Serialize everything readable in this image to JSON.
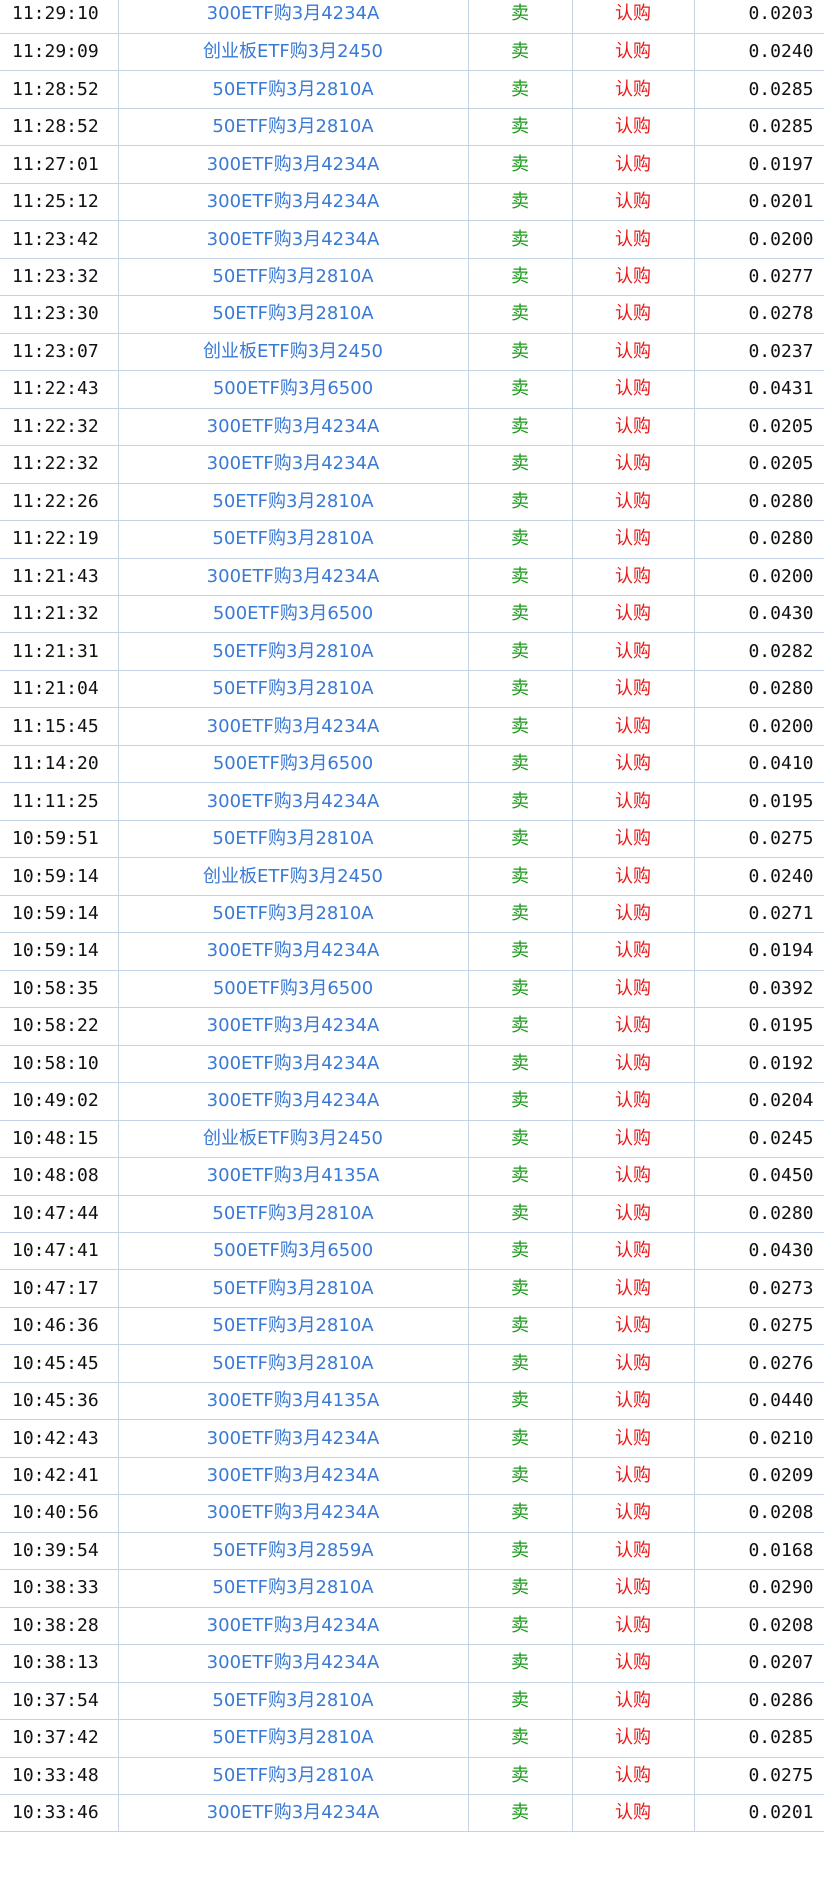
{
  "trades": [
    {
      "time": "11:29:10",
      "name": "300ETF购3月4234A",
      "side": "卖",
      "type": "认购",
      "price": "0.0203"
    },
    {
      "time": "11:29:09",
      "name": "创业板ETF购3月2450",
      "side": "卖",
      "type": "认购",
      "price": "0.0240"
    },
    {
      "time": "11:28:52",
      "name": "50ETF购3月2810A",
      "side": "卖",
      "type": "认购",
      "price": "0.0285"
    },
    {
      "time": "11:28:52",
      "name": "50ETF购3月2810A",
      "side": "卖",
      "type": "认购",
      "price": "0.0285"
    },
    {
      "time": "11:27:01",
      "name": "300ETF购3月4234A",
      "side": "卖",
      "type": "认购",
      "price": "0.0197"
    },
    {
      "time": "11:25:12",
      "name": "300ETF购3月4234A",
      "side": "卖",
      "type": "认购",
      "price": "0.0201"
    },
    {
      "time": "11:23:42",
      "name": "300ETF购3月4234A",
      "side": "卖",
      "type": "认购",
      "price": "0.0200"
    },
    {
      "time": "11:23:32",
      "name": "50ETF购3月2810A",
      "side": "卖",
      "type": "认购",
      "price": "0.0277"
    },
    {
      "time": "11:23:30",
      "name": "50ETF购3月2810A",
      "side": "卖",
      "type": "认购",
      "price": "0.0278"
    },
    {
      "time": "11:23:07",
      "name": "创业板ETF购3月2450",
      "side": "卖",
      "type": "认购",
      "price": "0.0237"
    },
    {
      "time": "11:22:43",
      "name": "500ETF购3月6500",
      "side": "卖",
      "type": "认购",
      "price": "0.0431"
    },
    {
      "time": "11:22:32",
      "name": "300ETF购3月4234A",
      "side": "卖",
      "type": "认购",
      "price": "0.0205"
    },
    {
      "time": "11:22:32",
      "name": "300ETF购3月4234A",
      "side": "卖",
      "type": "认购",
      "price": "0.0205"
    },
    {
      "time": "11:22:26",
      "name": "50ETF购3月2810A",
      "side": "卖",
      "type": "认购",
      "price": "0.0280"
    },
    {
      "time": "11:22:19",
      "name": "50ETF购3月2810A",
      "side": "卖",
      "type": "认购",
      "price": "0.0280"
    },
    {
      "time": "11:21:43",
      "name": "300ETF购3月4234A",
      "side": "卖",
      "type": "认购",
      "price": "0.0200"
    },
    {
      "time": "11:21:32",
      "name": "500ETF购3月6500",
      "side": "卖",
      "type": "认购",
      "price": "0.0430"
    },
    {
      "time": "11:21:31",
      "name": "50ETF购3月2810A",
      "side": "卖",
      "type": "认购",
      "price": "0.0282"
    },
    {
      "time": "11:21:04",
      "name": "50ETF购3月2810A",
      "side": "卖",
      "type": "认购",
      "price": "0.0280"
    },
    {
      "time": "11:15:45",
      "name": "300ETF购3月4234A",
      "side": "卖",
      "type": "认购",
      "price": "0.0200"
    },
    {
      "time": "11:14:20",
      "name": "500ETF购3月6500",
      "side": "卖",
      "type": "认购",
      "price": "0.0410"
    },
    {
      "time": "11:11:25",
      "name": "300ETF购3月4234A",
      "side": "卖",
      "type": "认购",
      "price": "0.0195"
    },
    {
      "time": "10:59:51",
      "name": "50ETF购3月2810A",
      "side": "卖",
      "type": "认购",
      "price": "0.0275"
    },
    {
      "time": "10:59:14",
      "name": "创业板ETF购3月2450",
      "side": "卖",
      "type": "认购",
      "price": "0.0240"
    },
    {
      "time": "10:59:14",
      "name": "50ETF购3月2810A",
      "side": "卖",
      "type": "认购",
      "price": "0.0271"
    },
    {
      "time": "10:59:14",
      "name": "300ETF购3月4234A",
      "side": "卖",
      "type": "认购",
      "price": "0.0194"
    },
    {
      "time": "10:58:35",
      "name": "500ETF购3月6500",
      "side": "卖",
      "type": "认购",
      "price": "0.0392"
    },
    {
      "time": "10:58:22",
      "name": "300ETF购3月4234A",
      "side": "卖",
      "type": "认购",
      "price": "0.0195"
    },
    {
      "time": "10:58:10",
      "name": "300ETF购3月4234A",
      "side": "卖",
      "type": "认购",
      "price": "0.0192"
    },
    {
      "time": "10:49:02",
      "name": "300ETF购3月4234A",
      "side": "卖",
      "type": "认购",
      "price": "0.0204"
    },
    {
      "time": "10:48:15",
      "name": "创业板ETF购3月2450",
      "side": "卖",
      "type": "认购",
      "price": "0.0245"
    },
    {
      "time": "10:48:08",
      "name": "300ETF购3月4135A",
      "side": "卖",
      "type": "认购",
      "price": "0.0450"
    },
    {
      "time": "10:47:44",
      "name": "50ETF购3月2810A",
      "side": "卖",
      "type": "认购",
      "price": "0.0280"
    },
    {
      "time": "10:47:41",
      "name": "500ETF购3月6500",
      "side": "卖",
      "type": "认购",
      "price": "0.0430"
    },
    {
      "time": "10:47:17",
      "name": "50ETF购3月2810A",
      "side": "卖",
      "type": "认购",
      "price": "0.0273"
    },
    {
      "time": "10:46:36",
      "name": "50ETF购3月2810A",
      "side": "卖",
      "type": "认购",
      "price": "0.0275"
    },
    {
      "time": "10:45:45",
      "name": "50ETF购3月2810A",
      "side": "卖",
      "type": "认购",
      "price": "0.0276"
    },
    {
      "time": "10:45:36",
      "name": "300ETF购3月4135A",
      "side": "卖",
      "type": "认购",
      "price": "0.0440"
    },
    {
      "time": "10:42:43",
      "name": "300ETF购3月4234A",
      "side": "卖",
      "type": "认购",
      "price": "0.0210"
    },
    {
      "time": "10:42:41",
      "name": "300ETF购3月4234A",
      "side": "卖",
      "type": "认购",
      "price": "0.0209"
    },
    {
      "time": "10:40:56",
      "name": "300ETF购3月4234A",
      "side": "卖",
      "type": "认购",
      "price": "0.0208"
    },
    {
      "time": "10:39:54",
      "name": "50ETF购3月2859A",
      "side": "卖",
      "type": "认购",
      "price": "0.0168"
    },
    {
      "time": "10:38:33",
      "name": "50ETF购3月2810A",
      "side": "卖",
      "type": "认购",
      "price": "0.0290"
    },
    {
      "time": "10:38:28",
      "name": "300ETF购3月4234A",
      "side": "卖",
      "type": "认购",
      "price": "0.0208"
    },
    {
      "time": "10:38:13",
      "name": "300ETF购3月4234A",
      "side": "卖",
      "type": "认购",
      "price": "0.0207"
    },
    {
      "time": "10:37:54",
      "name": "50ETF购3月2810A",
      "side": "卖",
      "type": "认购",
      "price": "0.0286"
    },
    {
      "time": "10:37:42",
      "name": "50ETF购3月2810A",
      "side": "卖",
      "type": "认购",
      "price": "0.0285"
    },
    {
      "time": "10:33:48",
      "name": "50ETF购3月2810A",
      "side": "卖",
      "type": "认购",
      "price": "0.0275"
    },
    {
      "time": "10:33:46",
      "name": "300ETF购3月4234A",
      "side": "卖",
      "type": "认购",
      "price": "0.0201"
    }
  ]
}
